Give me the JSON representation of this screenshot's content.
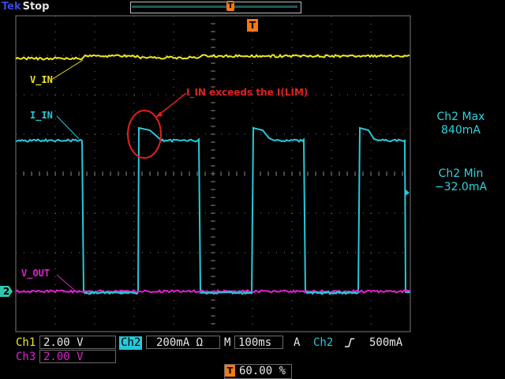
{
  "header": {
    "brand": "Tek",
    "run_state": "Stop",
    "trigger_position_icon": "T",
    "trigger_marker_icon": "T"
  },
  "traces": {
    "v_in_label": "V_IN",
    "i_in_label": "I_IN",
    "v_out_label": "V_OUT"
  },
  "annotation": {
    "text": "I_IN exceeds the I(LIM)"
  },
  "measurements": {
    "ch2_max_title": "Ch2 Max",
    "ch2_max_value": "840mA",
    "ch2_min_title": "Ch2 Min",
    "ch2_min_value": "−32.0mA"
  },
  "status_bar": {
    "ch1_label": "Ch1",
    "ch1_scale": "2.00 V",
    "ch2_label": "Ch2",
    "ch2_scale": "200mA Ω",
    "timebase_prefix": "M",
    "timebase": "100ms",
    "trigger_mode": "A",
    "trigger_source": "Ch2",
    "trigger_slope_icon": "rising-edge-icon",
    "trigger_level": "500mA",
    "ch3_label": "Ch3",
    "ch3_scale": "2.00 V",
    "trigger_percent": "60.00 %",
    "ch2_ground_marker": "2"
  },
  "colors": {
    "ch1": "#f0e61e",
    "ch2": "#28c8d8",
    "ch3": "#e020d0",
    "annotation": "#e02020",
    "trigger": "#f07a14",
    "grid": "#7a7a7a"
  }
}
